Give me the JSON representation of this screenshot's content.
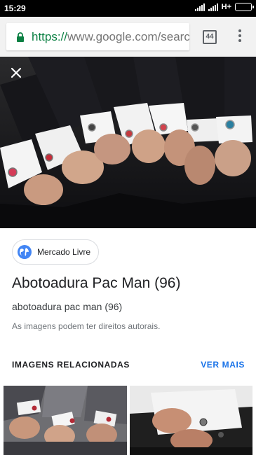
{
  "status_bar": {
    "time": "15:29",
    "network": "H+"
  },
  "browser": {
    "url_scheme": "https://",
    "url_rest": "www.google.com/search",
    "tab_count": "44",
    "icons": [
      "lock-icon",
      "tabs-icon",
      "overflow-menu-icon"
    ]
  },
  "viewer": {
    "close_icon": "close-icon"
  },
  "details": {
    "source": "Mercado Livre",
    "source_icon": "globe-icon",
    "title": "Abotoadura Pac Man (96)",
    "subtitle": "abotoadura pac man (96)",
    "copyright": "As imagens podem ter direitos autorais."
  },
  "related": {
    "heading": "IMAGENS RELACIONADAS",
    "see_more": "VER MAIS"
  },
  "colors": {
    "secure_green": "#0b8043",
    "link_blue": "#1a73e8",
    "globe_blue": "#4285f4"
  }
}
